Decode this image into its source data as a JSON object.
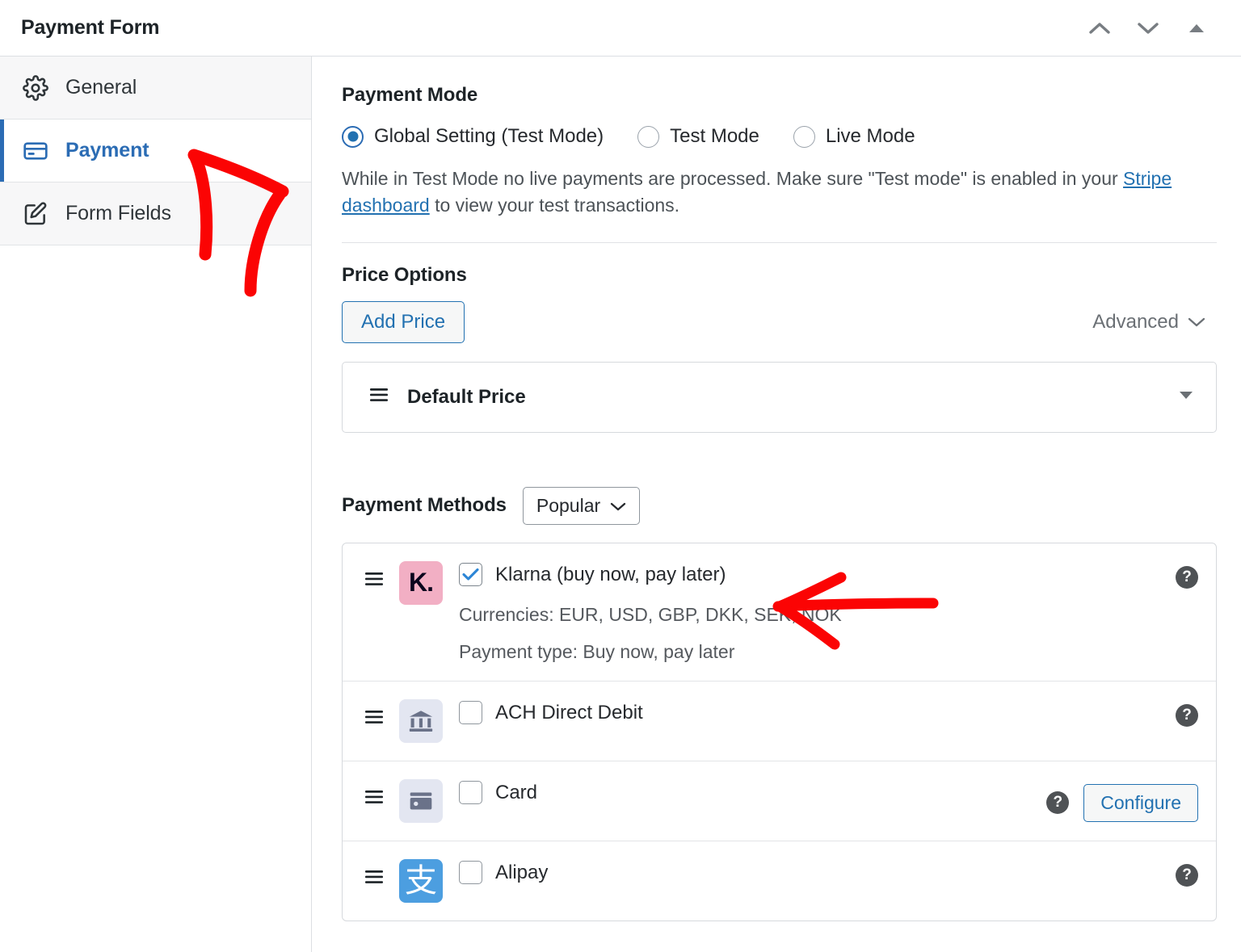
{
  "header": {
    "title": "Payment Form",
    "controls": [
      {
        "name": "move-up-icon"
      },
      {
        "name": "move-down-icon"
      },
      {
        "name": "collapse-icon"
      }
    ]
  },
  "sidebar": {
    "items": [
      {
        "label": "General",
        "icon": "gear-icon",
        "active": false
      },
      {
        "label": "Payment",
        "icon": "credit-card-icon",
        "active": true
      },
      {
        "label": "Form Fields",
        "icon": "edit-square-icon",
        "active": false
      }
    ]
  },
  "payment_mode": {
    "title": "Payment Mode",
    "options": [
      {
        "label": "Global Setting (Test Mode)",
        "selected": true
      },
      {
        "label": "Test Mode",
        "selected": false
      },
      {
        "label": "Live Mode",
        "selected": false
      }
    ],
    "description_before_link": "While in Test Mode no live payments are processed. Make sure \"Test mode\" is enabled in your ",
    "link_text": "Stripe dashboard",
    "description_after_link": " to view your test transactions."
  },
  "price_options": {
    "title": "Price Options",
    "add_price_label": "Add Price",
    "advanced_label": "Advanced",
    "cards": [
      {
        "name": "Default Price"
      }
    ]
  },
  "payment_methods": {
    "title": "Payment Methods",
    "filter_value": "Popular",
    "configure_label": "Configure",
    "help_glyph": "?",
    "rows": [
      {
        "id": "klarna",
        "label": "Klarna (buy now, pay later)",
        "checked": true,
        "icon": "klarna-icon",
        "icon_text": "K.",
        "meta": [
          "Currencies: EUR, USD, GBP, DKK, SEK, NOK",
          "Payment type: Buy now, pay later"
        ],
        "has_configure": false
      },
      {
        "id": "ach",
        "label": "ACH Direct Debit",
        "checked": false,
        "icon": "bank-icon",
        "meta": [],
        "has_configure": false
      },
      {
        "id": "card",
        "label": "Card",
        "checked": false,
        "icon": "credit-card-icon",
        "meta": [],
        "has_configure": true
      },
      {
        "id": "alipay",
        "label": "Alipay",
        "checked": false,
        "icon": "alipay-icon",
        "icon_text": "支",
        "meta": [],
        "has_configure": false
      }
    ]
  },
  "colors": {
    "accent_blue": "#2271b1",
    "annotation_red": "#fb0404",
    "klarna_pink": "#f2afc4",
    "alipay_blue": "#4c9ee0",
    "icon_gray_bg": "#e3e6f1"
  }
}
